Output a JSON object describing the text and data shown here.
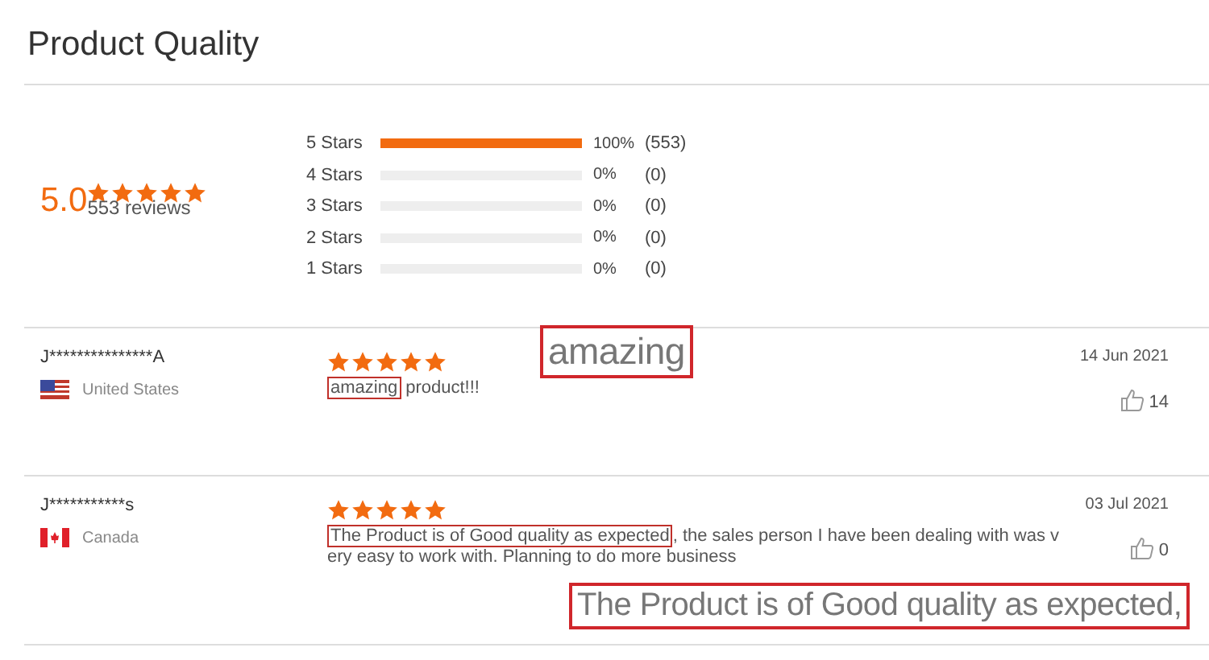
{
  "title": "Product Quality",
  "summary": {
    "rating": "5.0",
    "stars": 5,
    "review_count": "553 reviews"
  },
  "distribution": [
    {
      "label": "5 Stars",
      "level": 1,
      "percent": "100%",
      "count": "(553)"
    },
    {
      "label": "4 Stars",
      "level": 0,
      "percent": "0%",
      "count": "(0)"
    },
    {
      "label": "3 Stars",
      "level": 0,
      "percent": "0%",
      "count": "(0)"
    },
    {
      "label": "2 Stars",
      "level": 0,
      "percent": "0%",
      "count": "(0)"
    },
    {
      "label": "1 Stars",
      "level": 0,
      "percent": "0%",
      "count": "(0)"
    }
  ],
  "reviews": [
    {
      "name": "J***************A",
      "flag": {
        "kind": "us"
      },
      "country": "United States",
      "stars": 5,
      "highlight": "amazing",
      "body_lines": [
        "product!!!"
      ],
      "callout": "amazing",
      "date": "14 Jun 2021",
      "likes": "14"
    },
    {
      "name": "J***********s",
      "flag": {
        "kind": "ca"
      },
      "country": "Canada",
      "stars": 5,
      "highlight": "The Product is of Good quality as expected",
      "body_lines": [
        ", the sales person I have been dealing with was v",
        "ery easy to work with. Planning to do more business"
      ],
      "callout": "The Product is of Good quality as expected,",
      "date": "03 Jul 2021",
      "likes": "0"
    }
  ]
}
